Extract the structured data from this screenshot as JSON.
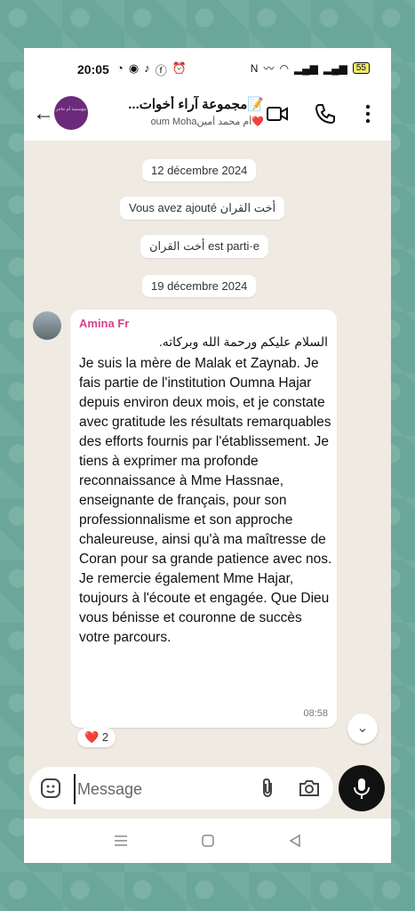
{
  "status_bar": {
    "time": "20:05",
    "battery": "55"
  },
  "header": {
    "group_title": "📝مجموعة آراء أخوات...",
    "group_subtitle": "❤️أم محمد أمينoum Moha",
    "back_icon": "arrow-left-icon",
    "video_icon": "video-call-icon",
    "call_icon": "phone-icon",
    "menu_icon": "more-vert-icon"
  },
  "chat": {
    "date1": "12 décembre 2024",
    "system1": "Vous avez ajouté أخت القران",
    "system2": "أخت القران est parti·e",
    "date2": "19 décembre 2024",
    "message": {
      "sender": "Amina Fr",
      "greeting": "السلام عليكم ورحمة الله وبركاته.",
      "text": "Je suis la mère de Malak et Zaynab. Je fais partie de l'institution Oumna Hajar depuis environ deux mois, et je constate avec gratitude les résultats remarquables des efforts fournis par l'établissement. Je tiens à exprimer ma profonde reconnaissance à Mme Hassnae, enseignante de français, pour son professionnalisme et son approche chaleureuse, ainsi qu'à ma maîtresse de Coran pour sa grande patience avec nos. Je remercie également Mme Hajar, toujours à l'écoute et engagée. Que Dieu vous bénisse et couronne de succès votre parcours.",
      "time": "08:58",
      "reaction_emoji": "❤️",
      "reaction_count": "2"
    }
  },
  "composer": {
    "placeholder": "Message"
  },
  "colors": {
    "sender_name": "#d6438e",
    "chat_bg": "#efeae2",
    "outer_bg": "#6aa79a"
  }
}
